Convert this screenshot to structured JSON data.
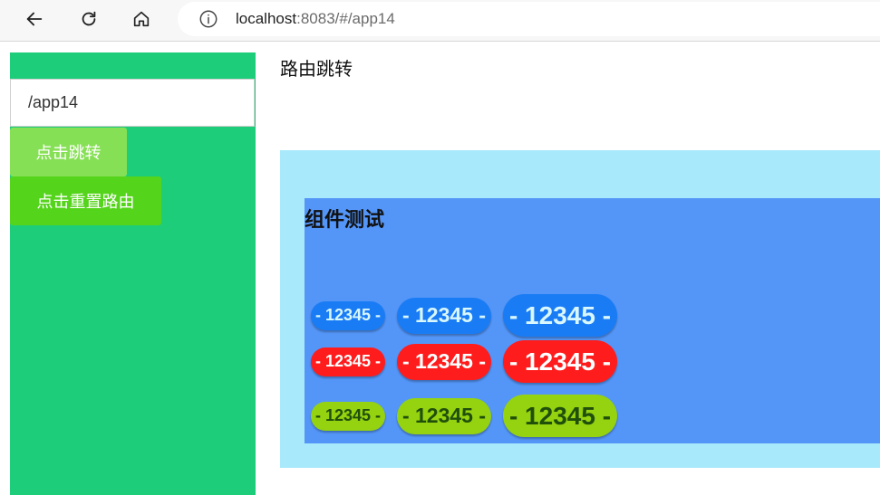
{
  "browser": {
    "url_host": "localhost",
    "url_rest": ":8083/#/app14"
  },
  "sidebar": {
    "route_input_value": "/app14",
    "jump_button_label": "点击跳转",
    "reset_button_label": "点击重置路由"
  },
  "main": {
    "page_title": "路由跳转",
    "component_title": "组件测试",
    "badge_text": "- 12345 -",
    "badge_rows": [
      {
        "name": "blue",
        "bg": "#1a7cf5",
        "text_color": "#d8f7ff",
        "badges": [
          {
            "size": "small",
            "text": "- 12345 -"
          },
          {
            "size": "medium",
            "text": "- 12345 -"
          },
          {
            "size": "large",
            "text": "- 12345 -"
          }
        ]
      },
      {
        "name": "red",
        "bg": "#ff1c1c",
        "text_color": "#ffffff",
        "badges": [
          {
            "size": "small",
            "text": "- 12345 -"
          },
          {
            "size": "medium",
            "text": "- 12345 -"
          },
          {
            "size": "large",
            "text": "- 12345 -"
          }
        ]
      },
      {
        "name": "green",
        "bg": "#95d20f",
        "text_color": "#1f4f0a",
        "badges": [
          {
            "size": "small",
            "text": "- 12345 -"
          },
          {
            "size": "medium",
            "text": "- 12345 -"
          },
          {
            "size": "large",
            "text": "- 12345 -"
          }
        ]
      }
    ]
  },
  "colors": {
    "sidebar_bg": "#1dcd7a",
    "outer_panel_bg": "#a8e9fb",
    "inner_panel_bg": "#5496f8",
    "jump_button_bg": "#86e055",
    "reset_button_bg": "#55d41c"
  }
}
